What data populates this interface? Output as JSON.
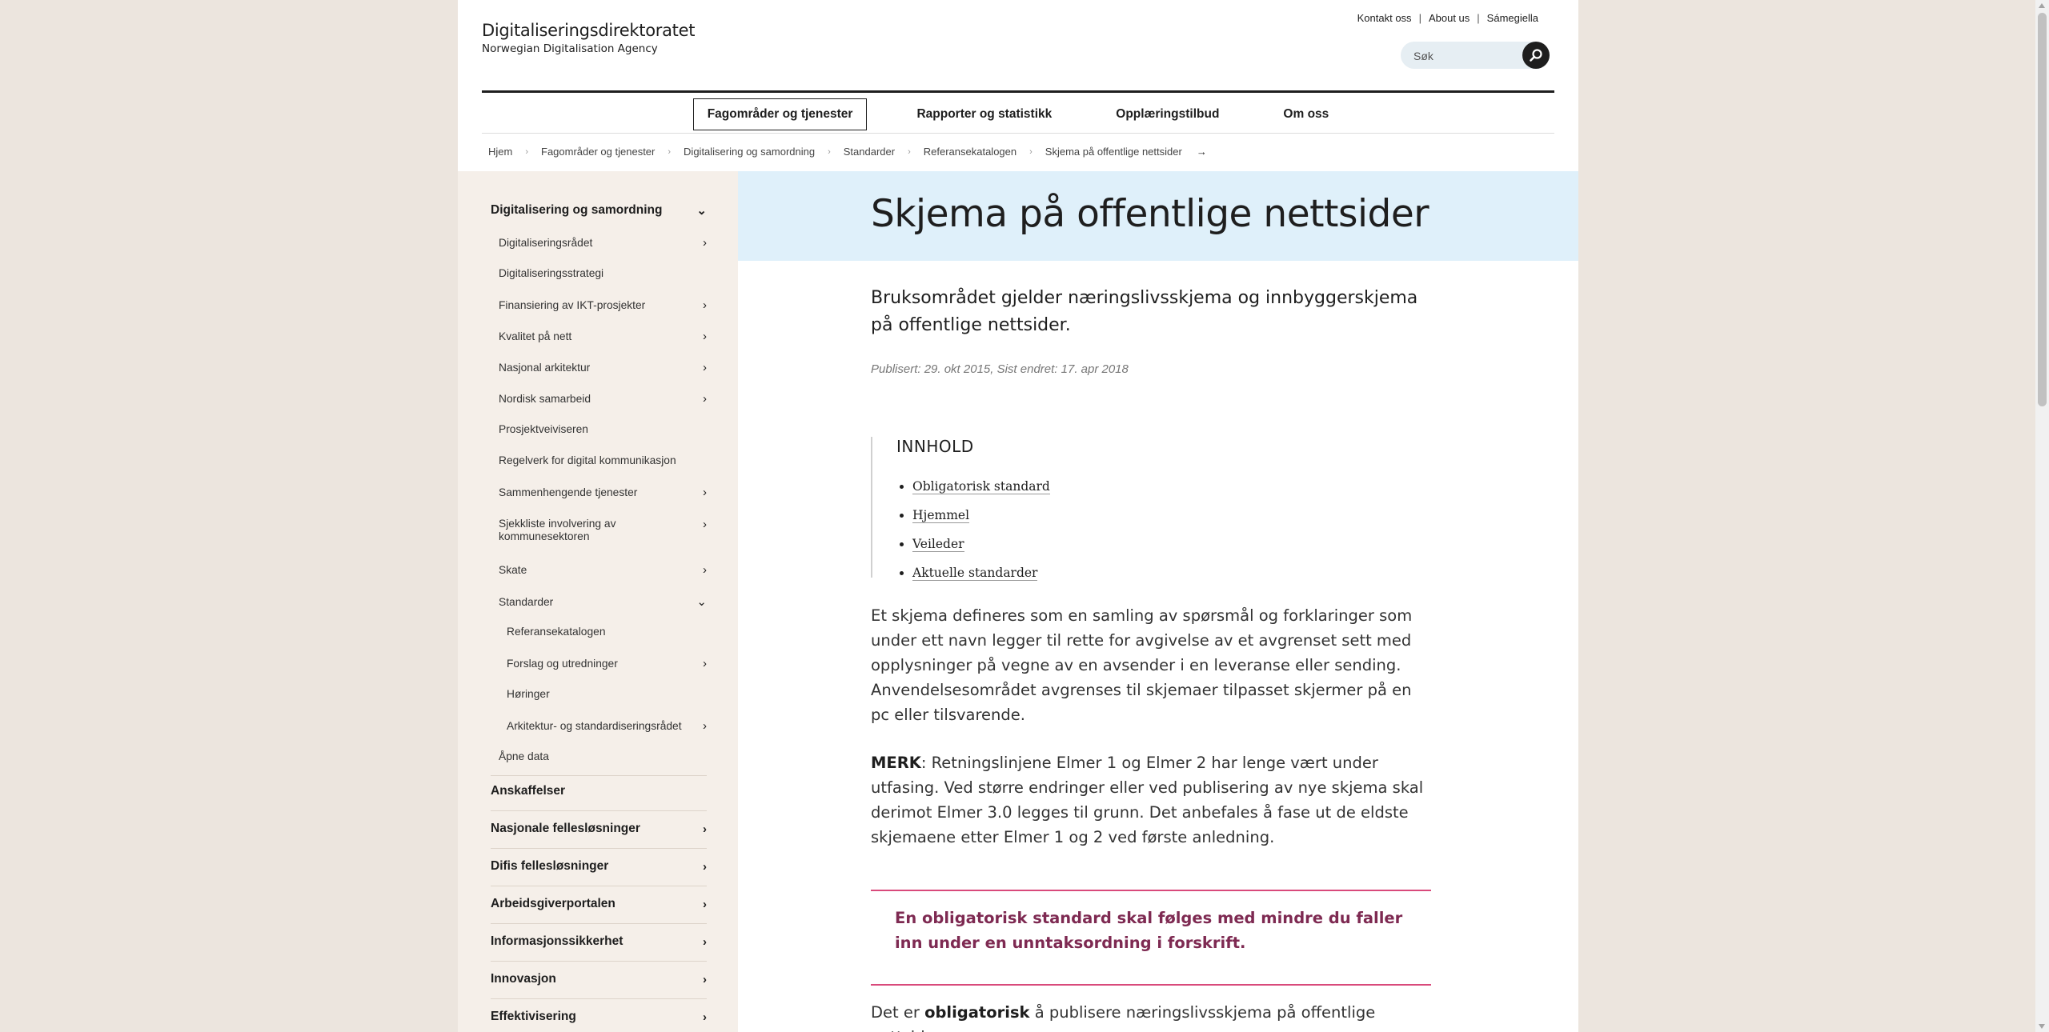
{
  "header": {
    "logo_title": "Digitaliseringsdirektoratet",
    "logo_subtitle": "Norwegian Digitalisation Agency",
    "top_links": [
      "Kontakt oss",
      "About us",
      "Sámegiella"
    ],
    "search_placeholder": "Søk",
    "search_icon": "magnifier-icon"
  },
  "main_nav": [
    "Fagområder og tjenester",
    "Rapporter og statistikk",
    "Opplæringstilbud",
    "Om oss"
  ],
  "breadcrumb": [
    "Hjem",
    "Fagområder og tjenester",
    "Digitalisering og samordning",
    "Standarder",
    "Referansekatalogen",
    "Skjema på offentlige nettsider"
  ],
  "breadcrumb_arrow": "→",
  "sidebar": {
    "section": "Digitalisering og samordning",
    "items": [
      "Digitaliseringsrådet",
      "Digitaliseringsstrategi",
      "Finansiering av IKT-prosjekter",
      "Kvalitet på nett",
      "Nasjonal arkitektur",
      "Nordisk samarbeid",
      "Prosjektveiviseren",
      "Regelverk for digital kommunikasjon",
      "Sammenhengende tjenester",
      "Sjekkliste involvering av kommunesektoren",
      "Skate",
      "Standarder",
      "Åpne data"
    ],
    "standarder_items": [
      "Referansekatalogen",
      "Forslag og utredninger",
      "Høringer",
      "Arkitektur- og standardiseringsrådet"
    ],
    "top_sections": [
      "Anskaffelser",
      "Nasjonale fellesløsninger",
      "Difis fellesløsninger",
      "Arbeidsgiverportalen",
      "Informasjonssikkerhet",
      "Innovasjon",
      "Effektivisering"
    ],
    "chevron_right": "›",
    "chevron_down": "⌄"
  },
  "article": {
    "title": "Skjema på offentlige nettsider",
    "lead": "Bruksområdet gjelder næringslivsskjema og innbyggerskjema på offentlige nettsider.",
    "meta": "Publisert: 29. okt 2015, Sist endret: 17. apr 2018",
    "toc_heading": "INNHOLD",
    "toc": [
      "Obligatorisk standard",
      "Hjemmel",
      "Veileder",
      "Aktuelle standarder"
    ],
    "p1": "Et skjema defineres som en samling av spørsmål og forklaringer som under ett navn legger til rette for avgivelse av et avgrenset sett med opplysninger på vegne av en avsender i en leveranse eller sending. Anvendelsesområdet avgrenses til skjemaer tilpasset skjermer på en pc eller tilsvarende.",
    "p2_bold": "MERK",
    "p2": ": Retningslinjene Elmer 1 og Elmer 2 har lenge vært under utfasing. Ved større endringer eller ved publisering av nye skjema skal derimot Elmer 3.0 legges til grunn. Det anbefales å fase ut de eldste skjemaene etter Elmer 1 og 2 ved første anledning.",
    "notice": "En obligatorisk standard skal følges med mindre du faller inn under en unntaksordning i forskrift.",
    "p3_start": "Det er ",
    "p3_bold": "obligatorisk",
    "p3_end": " å publisere næringslivsskjema på offentlige nettsider"
  },
  "colors": {
    "accent_pink": "#d94a7b",
    "notice_text": "#7e2a52",
    "hero_bg": "#dff0fa",
    "sidebar_bg": "#f5efe9",
    "page_bg": "#ece5de"
  }
}
